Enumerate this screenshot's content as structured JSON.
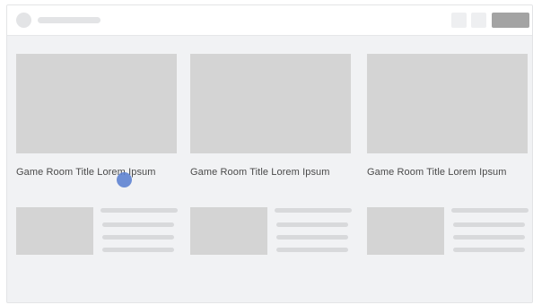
{
  "colors": {
    "placeholder": "#d4d4d4",
    "skeleton_line": "#d8d9db",
    "action_button": "#a3a3a3",
    "background": "#f1f2f4",
    "cursor": "#5a7fd0"
  },
  "header": {
    "avatar_icon": "avatar-placeholder",
    "title": "",
    "icons": [
      "icon-placeholder",
      "icon-placeholder"
    ],
    "action_label": ""
  },
  "cards": [
    {
      "title": "Game Room Title Lorem Ipsum"
    },
    {
      "title": "Game Room Title Lorem Ipsum"
    },
    {
      "title": "Game Room Title Lorem Ipsum"
    }
  ],
  "list_items": [
    {
      "lines": 4
    },
    {
      "lines": 4
    },
    {
      "lines": 4
    }
  ]
}
